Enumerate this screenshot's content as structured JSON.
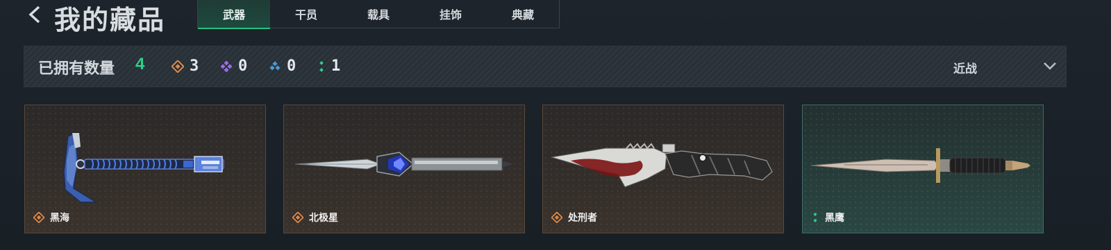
{
  "header": {
    "title": "我的藏品",
    "tabs": [
      {
        "label": "武器",
        "active": true
      },
      {
        "label": "干员",
        "active": false
      },
      {
        "label": "载具",
        "active": false
      },
      {
        "label": "挂饰",
        "active": false
      },
      {
        "label": "典藏",
        "active": false
      }
    ]
  },
  "summary": {
    "owned_label": "已拥有数量",
    "owned_count": "4",
    "rarities": [
      {
        "icon": "orange-diamond-icon",
        "color": "#e08a4a",
        "count": "3"
      },
      {
        "icon": "purple-diamond-icon",
        "color": "#9a6ee6",
        "count": "0"
      },
      {
        "icon": "blue-diamond-icon",
        "color": "#4a9ad9",
        "count": "0"
      },
      {
        "icon": "green-diamond-icon",
        "color": "#2fd08a",
        "count": "1"
      }
    ]
  },
  "filter": {
    "selected": "近战"
  },
  "items": [
    {
      "name": "黑海",
      "rarity_icon": "orange-diamond-icon",
      "rarity_color": "#e08a4a"
    },
    {
      "name": "北极星",
      "rarity_icon": "orange-diamond-icon",
      "rarity_color": "#e08a4a"
    },
    {
      "name": "处刑者",
      "rarity_icon": "orange-diamond-icon",
      "rarity_color": "#e08a4a"
    },
    {
      "name": "黑鹰",
      "rarity_icon": "green-diamond-icon",
      "rarity_color": "#2fd08a"
    }
  ],
  "colors": {
    "accent": "#2fd08a",
    "active_tab": "#1d4a3e",
    "orange_card_border": "#5a4a3b",
    "teal_card_border": "#3f6e68"
  }
}
